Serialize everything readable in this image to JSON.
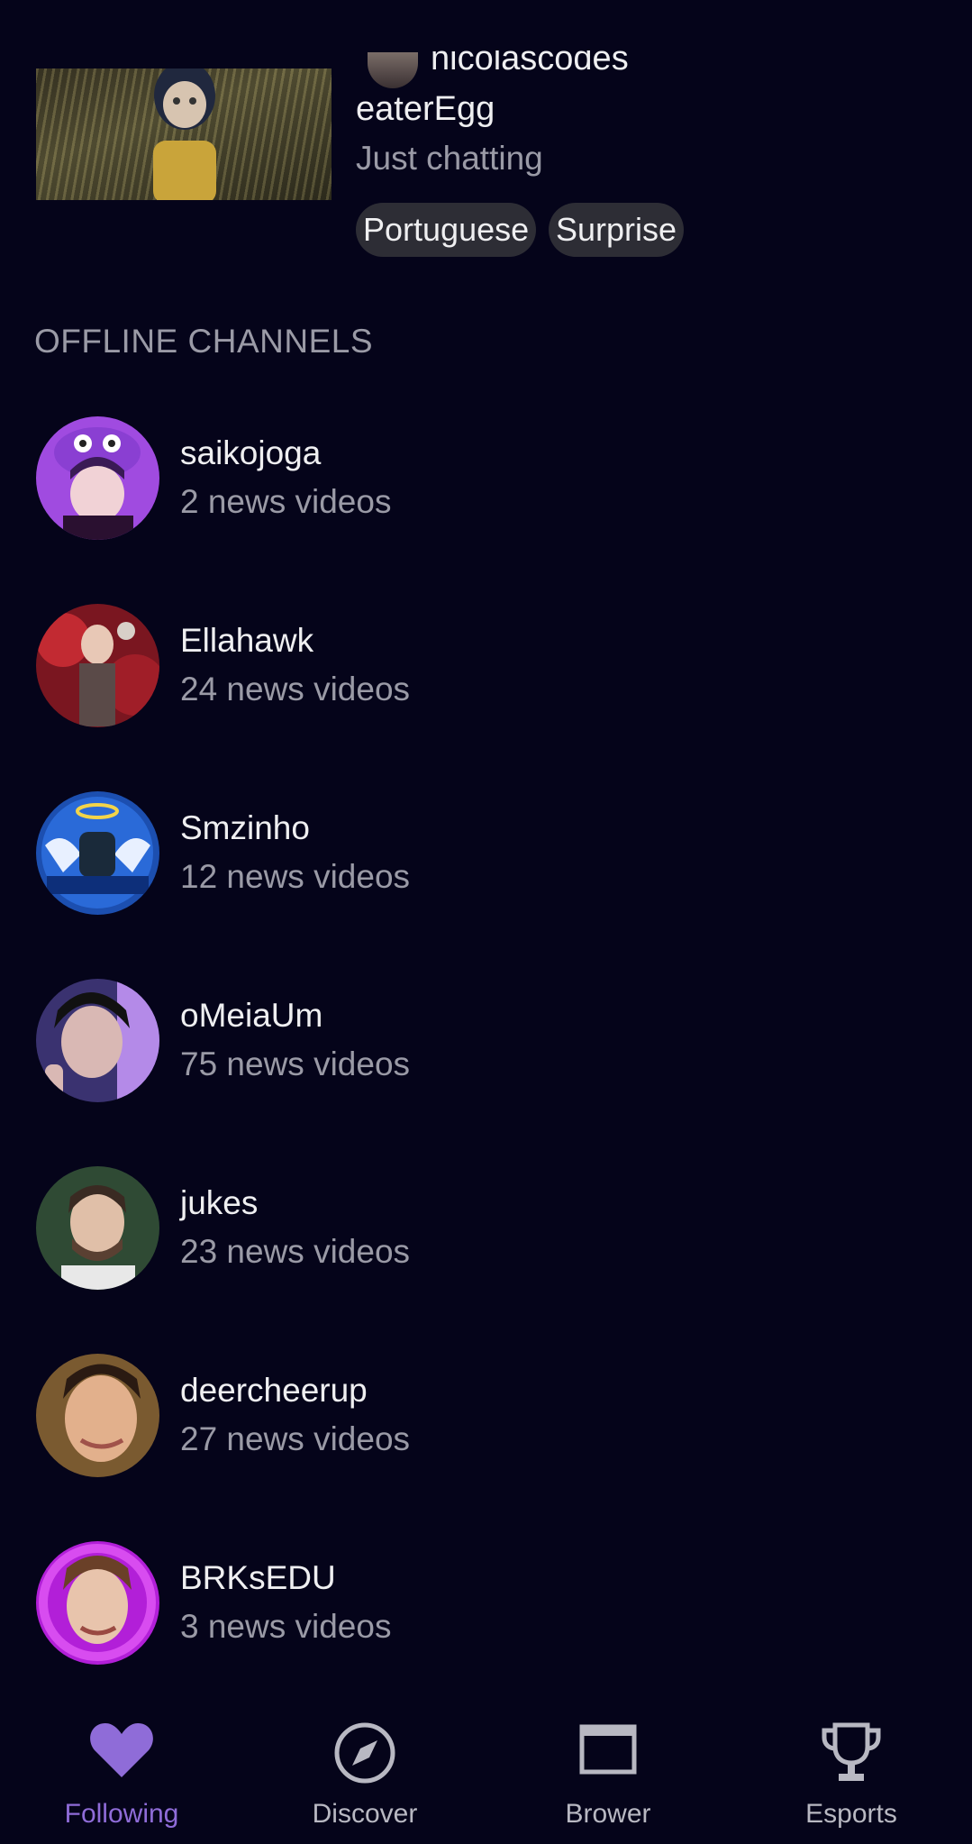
{
  "live_stream": {
    "streamer": "nicolascodes",
    "title": "eaterEgg",
    "category": "Just chatting",
    "tags": [
      "Portuguese",
      "Surprise"
    ]
  },
  "offline_section": {
    "title": "OFFLINE CHANNELS",
    "channels": [
      {
        "name": "saikojoga",
        "subtitle": "2 news videos"
      },
      {
        "name": "Ellahawk",
        "subtitle": "24 news videos"
      },
      {
        "name": "Smzinho",
        "subtitle": "12 news videos"
      },
      {
        "name": "oMeiaUm",
        "subtitle": "75 news videos"
      },
      {
        "name": "jukes",
        "subtitle": "23 news videos"
      },
      {
        "name": "deercheerup",
        "subtitle": "27 news videos"
      },
      {
        "name": "BRKsEDU",
        "subtitle": "3 news videos"
      }
    ]
  },
  "bottom_nav": {
    "items": [
      {
        "label": "Following",
        "icon": "heart-icon",
        "active": true
      },
      {
        "label": "Discover",
        "icon": "compass-icon",
        "active": false
      },
      {
        "label": "Brower",
        "icon": "browse-window-icon",
        "active": false
      },
      {
        "label": "Esports",
        "icon": "trophy-icon",
        "active": false
      }
    ]
  },
  "colors": {
    "background": "#05041a",
    "accent": "#8f6cd8",
    "text_primary": "#efeff1",
    "text_secondary": "#9a9aa6",
    "tag_bg": "#2d2d35"
  }
}
